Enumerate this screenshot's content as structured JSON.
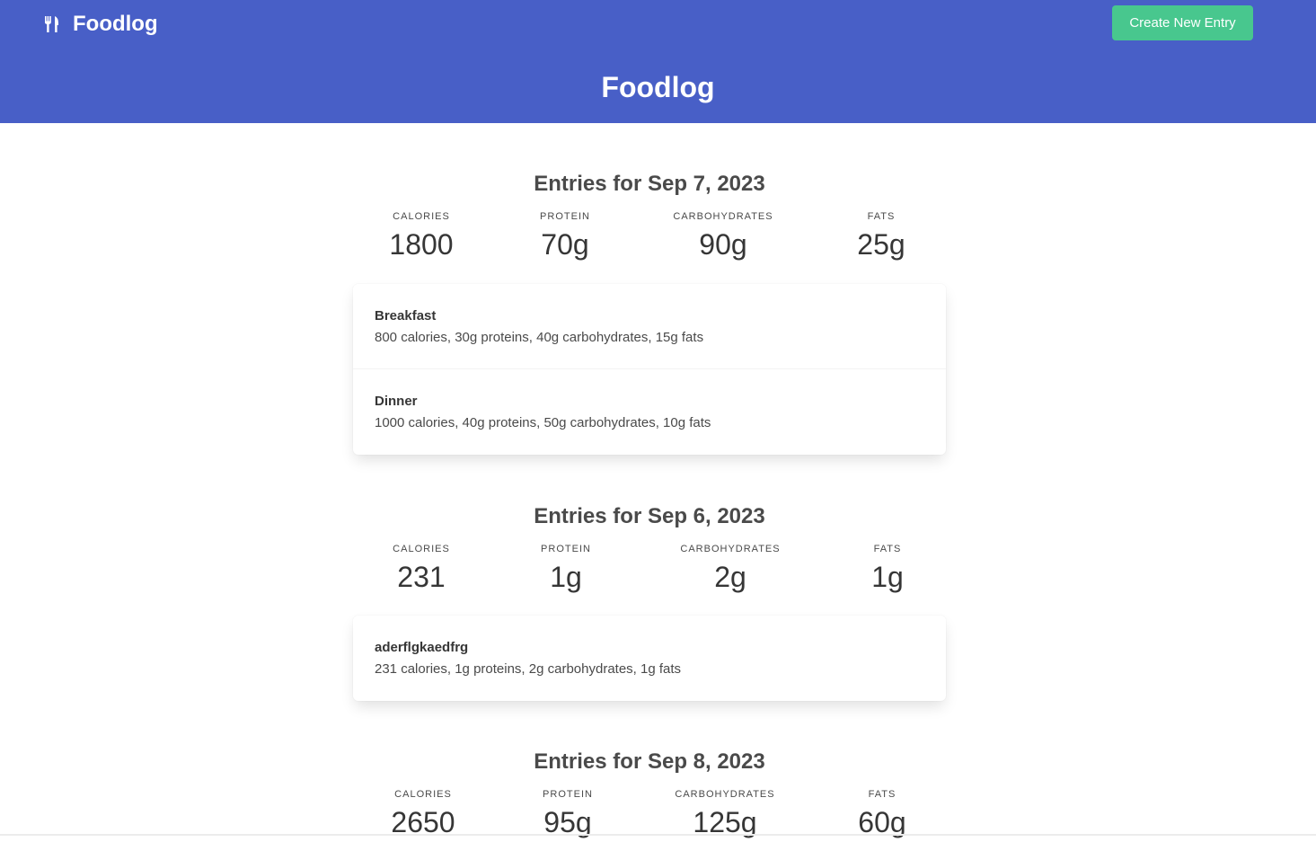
{
  "navbar": {
    "brand_icon": "utensils-icon",
    "brand_name": "Foodlog",
    "create_button_label": "Create New Entry"
  },
  "hero": {
    "title": "Foodlog"
  },
  "colors": {
    "primary": "#485fc7",
    "success": "#48c78e",
    "text": "#363636"
  },
  "days": [
    {
      "heading": "Entries for Sep 7, 2023",
      "stats": [
        {
          "label": "Calories",
          "value": "1800"
        },
        {
          "label": "Protein",
          "value": "70g"
        },
        {
          "label": "Carbohydrates",
          "value": "90g"
        },
        {
          "label": "Fats",
          "value": "25g"
        }
      ],
      "entries": [
        {
          "name": "Breakfast",
          "details": "800 calories, 30g proteins, 40g carbohydrates, 15g fats"
        },
        {
          "name": "Dinner",
          "details": "1000 calories, 40g proteins, 50g carbohydrates, 10g fats"
        }
      ]
    },
    {
      "heading": "Entries for Sep 6, 2023",
      "stats": [
        {
          "label": "Calories",
          "value": "231"
        },
        {
          "label": "Protein",
          "value": "1g"
        },
        {
          "label": "Carbohydrates",
          "value": "2g"
        },
        {
          "label": "Fats",
          "value": "1g"
        }
      ],
      "entries": [
        {
          "name": "aderflgkaedfrg",
          "details": "231 calories, 1g proteins, 2g carbohydrates, 1g fats"
        }
      ]
    },
    {
      "heading": "Entries for Sep 8, 2023",
      "stats": [
        {
          "label": "Calories",
          "value": "2650"
        },
        {
          "label": "Protein",
          "value": "95g"
        },
        {
          "label": "Carbohydrates",
          "value": "125g"
        },
        {
          "label": "Fats",
          "value": "60g"
        }
      ],
      "entries": []
    }
  ]
}
